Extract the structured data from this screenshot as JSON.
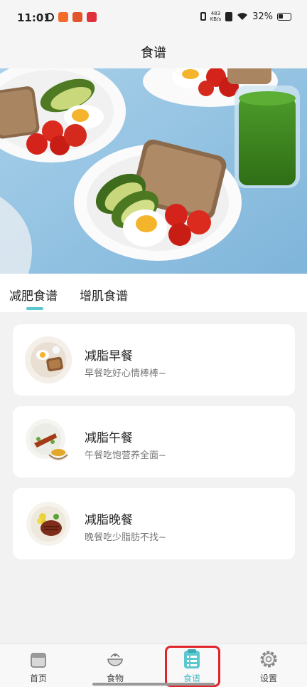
{
  "status": {
    "time": "11:01",
    "net_speed_value": "483",
    "net_speed_unit": "KB/s",
    "battery": "32%"
  },
  "header": {
    "title": "食谱"
  },
  "tabs": [
    {
      "label": "减肥食谱",
      "active": true
    },
    {
      "label": "增肌食谱",
      "active": false
    }
  ],
  "meals": [
    {
      "title": "减脂早餐",
      "subtitle": "早餐吃好心情棒棒~",
      "icon": "breakfast-plate-icon"
    },
    {
      "title": "减脂午餐",
      "subtitle": "午餐吃饱营养全面~",
      "icon": "lunch-plate-icon"
    },
    {
      "title": "减脂晚餐",
      "subtitle": "晚餐吃少脂肪不找~",
      "icon": "dinner-plate-icon"
    }
  ],
  "bottom_nav": [
    {
      "label": "首页",
      "icon": "home-icon",
      "active": false
    },
    {
      "label": "食物",
      "icon": "food-bowl-icon",
      "active": false
    },
    {
      "label": "食谱",
      "icon": "recipe-list-icon",
      "active": true
    },
    {
      "label": "设置",
      "icon": "settings-gear-icon",
      "active": false
    }
  ],
  "colors": {
    "accent": "#5bc7cf",
    "highlight_box": "#e0252b",
    "hero_background": "#a9cfe6"
  }
}
